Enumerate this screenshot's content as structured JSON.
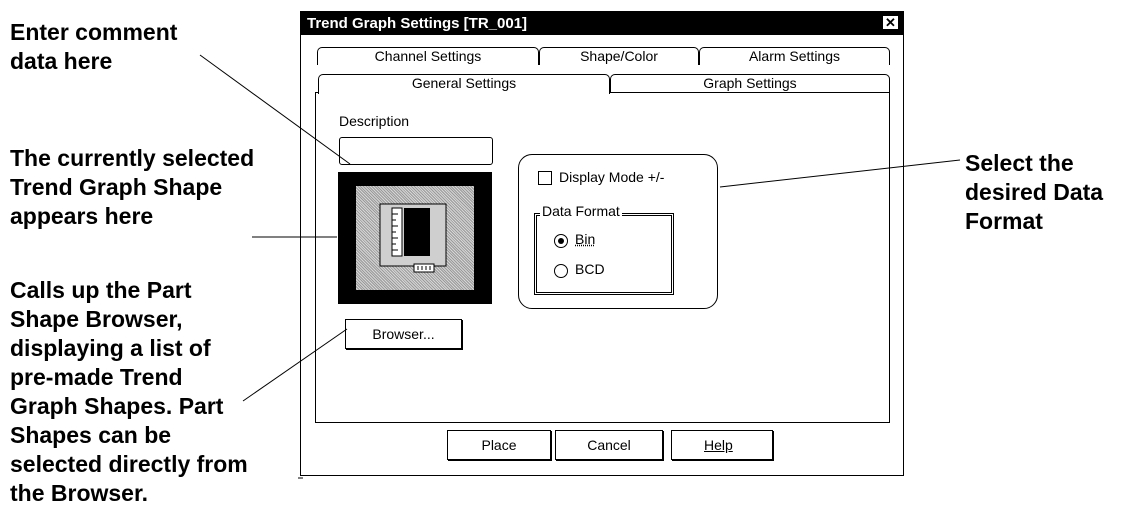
{
  "callouts": {
    "comment": "Enter comment\ndata here",
    "shape": "The currently selected\nTrend Graph Shape\nappears here",
    "browser": "Calls up the Part\nShape Browser,\ndisplaying a list of\npre-made Trend\nGraph Shapes. Part\nShapes can be\nselected directly from\nthe Browser.",
    "format": "Select the\ndesired Data\nFormat"
  },
  "dialog": {
    "title": "Trend Graph Settings [TR_001]",
    "close_glyph": "✕",
    "tabs_row1": [
      "Channel Settings",
      "Shape/Color",
      "Alarm Settings"
    ],
    "tabs_row2": [
      "General Settings",
      "Graph Settings"
    ],
    "description_label": "Description",
    "description_value": "",
    "display_mode_label": "Display Mode +/-",
    "data_format_label": "Data Format",
    "radio_bin": "Bin",
    "radio_bcd": "BCD",
    "browser_button": "Browser...",
    "place_button": "Place",
    "cancel_button": "Cancel",
    "help_button": "Help"
  }
}
